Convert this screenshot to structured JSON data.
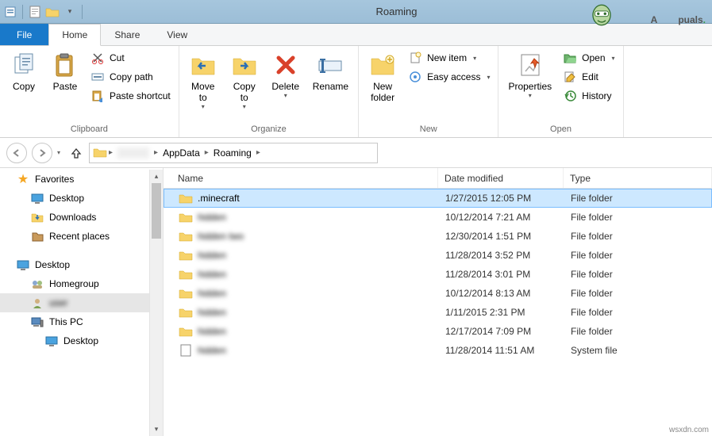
{
  "window": {
    "title": "Roaming"
  },
  "watermark": {
    "brand_pre": "A",
    "brand_post": "puals",
    "dot": "."
  },
  "tabs": {
    "file": "File",
    "home": "Home",
    "share": "Share",
    "view": "View"
  },
  "ribbon": {
    "clipboard": {
      "label": "Clipboard",
      "copy": "Copy",
      "paste": "Paste",
      "cut": "Cut",
      "copy_path": "Copy path",
      "paste_shortcut": "Paste shortcut"
    },
    "organize": {
      "label": "Organize",
      "move_to": "Move\nto",
      "copy_to": "Copy\nto",
      "delete": "Delete",
      "rename": "Rename"
    },
    "new": {
      "label": "New",
      "new_folder": "New\nfolder",
      "new_item": "New item",
      "easy_access": "Easy access"
    },
    "open": {
      "label": "Open",
      "properties": "Properties",
      "open": "Open",
      "edit": "Edit",
      "history": "History"
    }
  },
  "breadcrumbs": {
    "items": [
      "AppData",
      "Roaming"
    ]
  },
  "nav_dropdown": "▾",
  "columns": {
    "name": "Name",
    "date": "Date modified",
    "type": "Type"
  },
  "sidebar": {
    "favorites": "Favorites",
    "fav_children": [
      "Desktop",
      "Downloads",
      "Recent places"
    ],
    "desktop": "Desktop",
    "desk_children": [
      "Homegroup",
      "user",
      "This PC",
      "Desktop"
    ]
  },
  "files": [
    {
      "name": ".minecraft",
      "date": "1/27/2015 12:05 PM",
      "type": "File folder",
      "selected": true,
      "blurred": false,
      "icon": "folder"
    },
    {
      "name": "hidden",
      "date": "10/12/2014 7:21 AM",
      "type": "File folder",
      "selected": false,
      "blurred": true,
      "icon": "folder"
    },
    {
      "name": "hidden two",
      "date": "12/30/2014 1:51 PM",
      "type": "File folder",
      "selected": false,
      "blurred": true,
      "icon": "folder"
    },
    {
      "name": "hidden",
      "date": "11/28/2014 3:52 PM",
      "type": "File folder",
      "selected": false,
      "blurred": true,
      "icon": "folder"
    },
    {
      "name": "hidden",
      "date": "11/28/2014 3:01 PM",
      "type": "File folder",
      "selected": false,
      "blurred": true,
      "icon": "folder"
    },
    {
      "name": "hidden",
      "date": "10/12/2014 8:13 AM",
      "type": "File folder",
      "selected": false,
      "blurred": true,
      "icon": "folder"
    },
    {
      "name": "hidden",
      "date": "1/11/2015 2:31 PM",
      "type": "File folder",
      "selected": false,
      "blurred": true,
      "icon": "folder"
    },
    {
      "name": "hidden",
      "date": "12/17/2014 7:09 PM",
      "type": "File folder",
      "selected": false,
      "blurred": true,
      "icon": "folder"
    },
    {
      "name": "hidden",
      "date": "11/28/2014 11:51 AM",
      "type": "System file",
      "selected": false,
      "blurred": true,
      "icon": "file"
    }
  ],
  "source_url": "wsxdn.com"
}
